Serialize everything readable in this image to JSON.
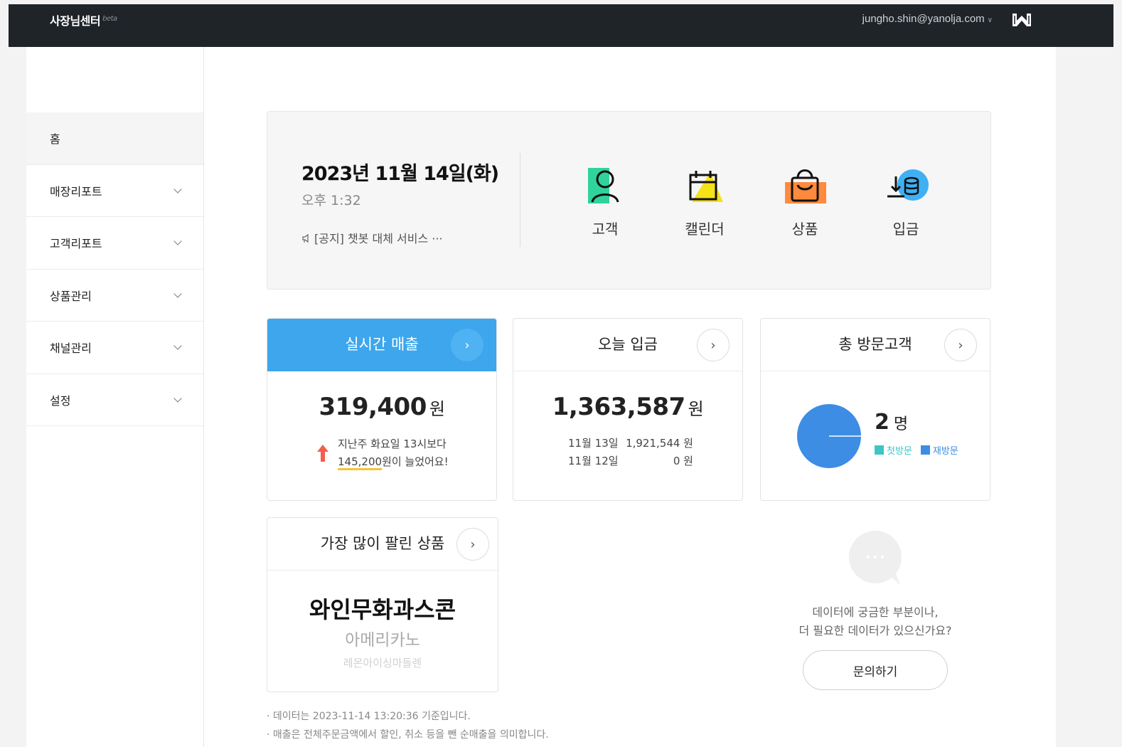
{
  "header": {
    "brand": "사장님센터",
    "brand_tag": "beta",
    "user_email": "jungho.shin@yanolja.com"
  },
  "sidebar": {
    "items": [
      {
        "label": "홈"
      },
      {
        "label": "매장리포트"
      },
      {
        "label": "고객리포트"
      },
      {
        "label": "상품관리"
      },
      {
        "label": "채널관리"
      },
      {
        "label": "설정"
      }
    ]
  },
  "hero": {
    "date": "2023년 11월 14일(화)",
    "time": "오후 1:32",
    "notice": "[공지] 챗봇 대체 서비스 ···",
    "shortcuts": [
      {
        "label": "고객",
        "icon": "person-icon",
        "color": "#2fd39b"
      },
      {
        "label": "캘린더",
        "icon": "calendar-icon",
        "color": "#f5e218"
      },
      {
        "label": "상품",
        "icon": "shopping-bag-icon",
        "color": "#ff8a3d"
      },
      {
        "label": "입금",
        "icon": "coin-deposit-icon",
        "color": "#3fb0f3"
      }
    ]
  },
  "realtime_sales": {
    "title": "실시간 매출",
    "amount": "319,400",
    "unit": "원",
    "compare_line1": "지난주 화요일 13시보다",
    "compare_amount": "145,200",
    "compare_line2": "원이 늘었어요!",
    "trend": "up",
    "trend_color": "#f25f4c"
  },
  "today_deposit": {
    "title": "오늘 입금",
    "amount": "1,363,587",
    "unit": "원",
    "history": [
      {
        "date": "11월 13일",
        "amount": "1,921,544 원"
      },
      {
        "date": "11월 12일",
        "amount": "0 원"
      }
    ]
  },
  "visitors": {
    "title": "총 방문고객",
    "count": "2",
    "unit": "명",
    "legend": [
      {
        "label": "첫방문",
        "color": "#3cc6c6"
      },
      {
        "label": "재방문",
        "color": "#3c8de3"
      }
    ],
    "pie": {
      "first_visit": 0,
      "revisit": 2
    }
  },
  "best_products": {
    "title": "가장 많이 팔린 상품",
    "items": [
      "와인무화과스콘",
      "아메리카노",
      "레몬아이싱마들렌"
    ]
  },
  "inquiry": {
    "line1": "데이터에 궁금한 부분이나,",
    "line2": "더 필요한 데이터가 있으신가요?",
    "button": "문의하기"
  },
  "footnotes": [
    "· 데이터는 2023-11-14 13:20:36 기준입니다.",
    "· 매출은 전체주문금액에서 할인, 취소 등을 뺀 순매출을 의미합니다."
  ],
  "accent": "#3da6ec"
}
